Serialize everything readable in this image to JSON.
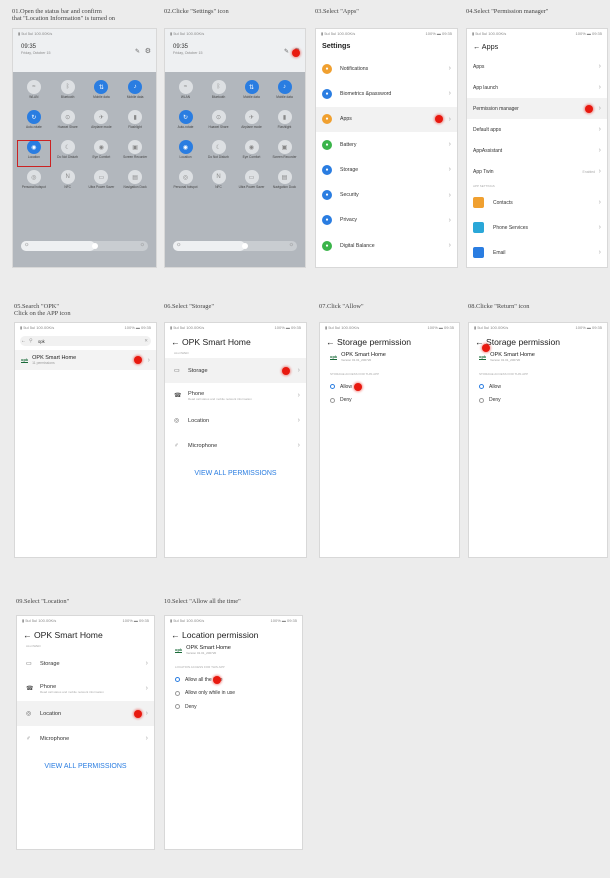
{
  "captions": [
    "01.Open the status bar and confirm\nthat \"Location Information\" is turned on",
    "02.Clicke \"Settings\" icon",
    "03.Select \"Apps\"",
    "04.Select \"Permission manager\"",
    "05.Search \"OPK\"\nClick on the APP icon",
    "06.Select \"Storage\"",
    "07.Click \"Allow\"",
    "08.Clicke \"Return\" icon",
    "09.Select \"Location\"",
    "10.Select \"Allow all the time\""
  ],
  "status_bar": {
    "left": "▮ 5ul 5ul 100.00K/s",
    "right": "100% ▬ 09:35"
  },
  "control_center": {
    "time": "09:35",
    "date": "Friday, October 15",
    "tiles": [
      {
        "label": "WLAN",
        "on": false,
        "icon": "wifi-icon"
      },
      {
        "label": "Bluetooth",
        "on": false,
        "icon": "bluetooth-icon"
      },
      {
        "label": "Mobile data",
        "on": true,
        "icon": "mobile-data-icon"
      },
      {
        "label": "Mobile data",
        "on": true,
        "icon": "bell-icon"
      },
      {
        "label": "Auto-rotate",
        "on": true,
        "icon": "rotate-icon"
      },
      {
        "label": "Huawei Share",
        "on": false,
        "icon": "share-icon"
      },
      {
        "label": "Airplane mode",
        "on": false,
        "icon": "airplane-icon"
      },
      {
        "label": "Flashlight",
        "on": false,
        "icon": "flashlight-icon"
      },
      {
        "label": "Location",
        "on": true,
        "icon": "location-pin-icon"
      },
      {
        "label": "Do Not Disturb",
        "on": false,
        "icon": "moon-icon"
      },
      {
        "label": "Eye Comfort",
        "on": false,
        "icon": "eye-icon"
      },
      {
        "label": "Screen Recorder",
        "on": false,
        "icon": "video-icon"
      },
      {
        "label": "Personal hotspot",
        "on": false,
        "icon": "hotspot-icon"
      },
      {
        "label": "NFC",
        "on": false,
        "icon": "nfc-icon"
      },
      {
        "label": "Ultra Power Saver",
        "on": false,
        "icon": "battery-icon"
      },
      {
        "label": "Navigation Dock",
        "on": false,
        "icon": "dock-icon"
      }
    ]
  },
  "settings": {
    "title": "Settings",
    "items": [
      {
        "label": "Notifications",
        "color": "#f0a030"
      },
      {
        "label": "Biometrics &password",
        "color": "#2a7de1"
      },
      {
        "label": "Apps",
        "color": "#f0a030"
      },
      {
        "label": "Battery",
        "color": "#3ab44a"
      },
      {
        "label": "Storage",
        "color": "#2a7de1"
      },
      {
        "label": "Security",
        "color": "#2a7de1"
      },
      {
        "label": "Privacy",
        "color": "#2a7de1"
      },
      {
        "label": "Digital Balance",
        "color": "#3ab44a"
      }
    ]
  },
  "apps": {
    "title": "← Apps",
    "items": [
      "Apps",
      "App launch",
      "Permission manager",
      "Default apps",
      "AppAssistant",
      "App Twin"
    ],
    "twin_tag": "Enabled",
    "section": "APP SETTINGS",
    "extra": [
      {
        "label": "Contacts",
        "color": "#f0a030"
      },
      {
        "label": "Phone Services",
        "color": "#2aa7d8"
      },
      {
        "label": "Email",
        "color": "#2a7de1"
      }
    ]
  },
  "search": {
    "query": "opk",
    "app_logo": "opk",
    "app_name": "OPK Smart Home",
    "app_sub": "11 permissions"
  },
  "app_detail": {
    "title": "←  OPK Smart Home",
    "section": "ALLOWED",
    "items": [
      {
        "label": "Storage",
        "icon": "folder-icon"
      },
      {
        "label": "Phone",
        "sub": "Read call status and mobile network information",
        "icon": "phone-icon"
      },
      {
        "label": "Location",
        "icon": "location-icon"
      },
      {
        "label": "Microphone",
        "icon": "microphone-icon"
      }
    ],
    "view_all": "VIEW ALL PERMISSIONS"
  },
  "storage_permission": {
    "title": "←  Storage permission",
    "app_name": "OPK Smart Home",
    "version": "Version 01.01_200720",
    "section": "STORAGE ACCESS FOR THIS APP",
    "options": [
      "Allow",
      "Deny"
    ]
  },
  "location_permission": {
    "title": "←  Location permission",
    "app_name": "OPK Smart Home",
    "version": "Version 01.01_200720",
    "section": "LOCATION ACCESS FOR THIS APP",
    "options": [
      "Allow all the time",
      "Allow only while in use",
      "Deny"
    ]
  }
}
